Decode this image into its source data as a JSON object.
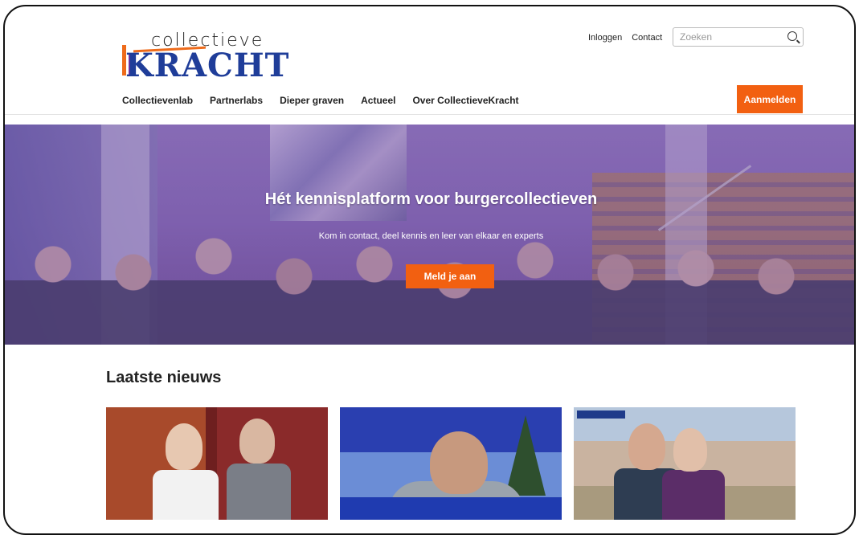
{
  "header": {
    "logo": {
      "top_text": "collectieve",
      "main_text": "KRACHT"
    },
    "toplinks": {
      "login": "Inloggen",
      "contact": "Contact"
    },
    "search": {
      "placeholder": "Zoeken"
    },
    "nav": [
      "Collectievenlab",
      "Partnerlabs",
      "Dieper graven",
      "Actueel",
      "Over CollectieveKracht"
    ],
    "signup_label": "Aanmelden"
  },
  "hero": {
    "title": "Hét kennisplatform voor burgercollectieven",
    "subtitle": "Kom in contact, deel kennis en leer van elkaar en experts",
    "cta": "Meld je aan"
  },
  "news": {
    "title": "Laatste nieuws"
  },
  "colors": {
    "accent": "#f26011",
    "brand_blue": "#1f3d99"
  }
}
